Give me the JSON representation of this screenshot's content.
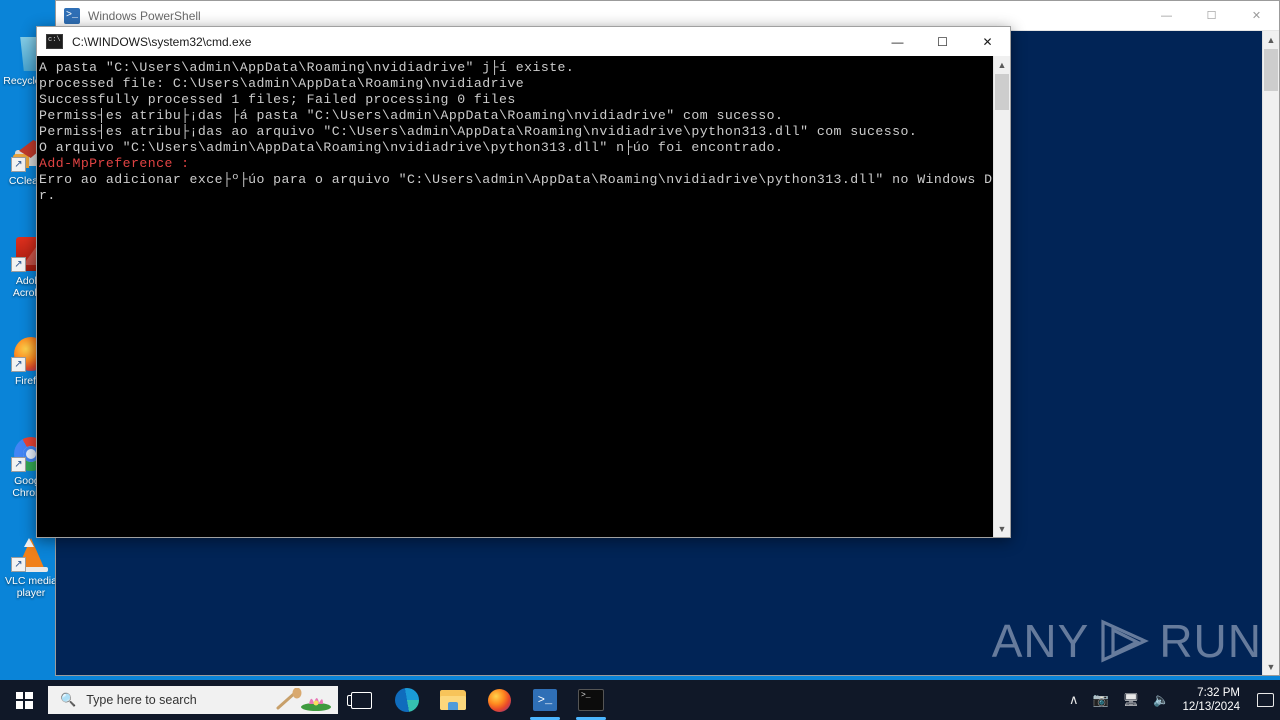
{
  "desktop": {
    "icons": [
      {
        "name": "recycle-bin",
        "label": "Recycle Bin",
        "art": "ico-recycle",
        "shortcut": false
      },
      {
        "name": "ccleaner",
        "label": "CCleaner",
        "art": "ico-ccleaner",
        "shortcut": true
      },
      {
        "name": "adobe-acrobat",
        "label": "Adobe Acrobat",
        "art": "ico-acrobat",
        "shortcut": true
      },
      {
        "name": "firefox",
        "label": "Firefox",
        "art": "ico-firefox",
        "shortcut": true
      },
      {
        "name": "google-chrome",
        "label": "Google Chrome",
        "art": "ico-chrome",
        "shortcut": true
      },
      {
        "name": "vlc-media-player",
        "label": "VLC media player",
        "art": "ico-vlc",
        "shortcut": true
      }
    ]
  },
  "watermark": {
    "left_text": "ANY",
    "right_text": "RUN"
  },
  "powershell_window": {
    "title": "Windows PowerShell",
    "icon": "powershell-icon",
    "minimize": "—",
    "maximize": "☐",
    "close": "✕",
    "background_color": "#012456"
  },
  "cmd_window": {
    "title": "C:\\WINDOWS\\system32\\cmd.exe",
    "icon": "cmd-icon",
    "minimize": "—",
    "maximize": "☐",
    "close": "✕",
    "background_color": "#000000",
    "console_lines": [
      {
        "text": "A pasta \"C:\\Users\\admin\\AppData\\Roaming\\nvidiadrive\" j├í existe.",
        "error": false
      },
      {
        "text": "processed file: C:\\Users\\admin\\AppData\\Roaming\\nvidiadrive",
        "error": false
      },
      {
        "text": "Successfully processed 1 files; Failed processing 0 files",
        "error": false
      },
      {
        "text": "Permiss┤es atribu├¡das ├á pasta \"C:\\Users\\admin\\AppData\\Roaming\\nvidiadrive\" com sucesso.",
        "error": false
      },
      {
        "text": "Permiss┤es atribu├¡das ao arquivo \"C:\\Users\\admin\\AppData\\Roaming\\nvidiadrive\\python313.dll\" com sucesso.",
        "error": false
      },
      {
        "text": "O arquivo \"C:\\Users\\admin\\AppData\\Roaming\\nvidiadrive\\python313.dll\" n├úo foi encontrado.",
        "error": false
      },
      {
        "text": "Add-MpPreference :",
        "error": true
      },
      {
        "text": "Erro ao adicionar exce├º├úo para o arquivo \"C:\\Users\\admin\\AppData\\Roaming\\nvidiadrive\\python313.dll\" no Windows Defende",
        "error": false
      },
      {
        "text": "r.",
        "error": false
      }
    ]
  },
  "taskbar": {
    "start_label": "Start",
    "search_placeholder": "Type here to search",
    "search_icon": "search-icon",
    "task_view_label": "Task View",
    "buttons": [
      {
        "name": "taskbar-edge",
        "label": "Microsoft Edge",
        "art": "ico-edge",
        "running": false
      },
      {
        "name": "taskbar-file-explorer",
        "label": "File Explorer",
        "art": "ico-explorer",
        "running": false
      },
      {
        "name": "taskbar-firefox",
        "label": "Firefox",
        "art": "ico-ffox",
        "running": false
      },
      {
        "name": "taskbar-powershell",
        "label": "Windows PowerShell",
        "art": "ico-psh",
        "running": true
      },
      {
        "name": "taskbar-cmd",
        "label": "cmd.exe",
        "art": "ico-cmd",
        "running": true
      }
    ],
    "tray": {
      "show_hidden_icons": "∧",
      "icons": [
        "camera-icon",
        "network-icon",
        "volume-icon"
      ],
      "time": "7:32 PM",
      "date": "12/13/2024",
      "action_center": "notifications-icon"
    }
  }
}
